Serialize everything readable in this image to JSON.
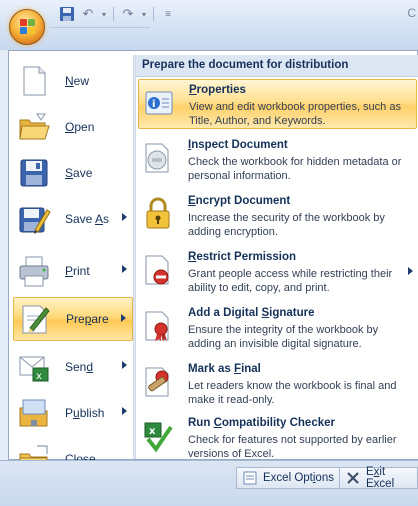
{
  "title_bar": {
    "partial_title": "C"
  },
  "left_menu": {
    "items": [
      {
        "label": "New",
        "mnemonic": "N",
        "rest": "ew",
        "has_submenu": false
      },
      {
        "label": "Open",
        "mnemonic": "O",
        "rest": "pen",
        "has_submenu": false
      },
      {
        "label": "Save",
        "mnemonic": "S",
        "rest": "ave",
        "has_submenu": false
      },
      {
        "label_pre": "Save ",
        "mnemonic": "A",
        "rest": "s",
        "has_submenu": true
      },
      {
        "label": "Print",
        "mnemonic": "P",
        "rest": "rint",
        "has_submenu": true
      },
      {
        "label_pre": "Pre",
        "mnemonic": "p",
        "rest": "are",
        "has_submenu": true,
        "selected": true
      },
      {
        "label_pre": "Sen",
        "mnemonic": "d",
        "rest": "",
        "has_submenu": true
      },
      {
        "label_pre": "P",
        "mnemonic": "u",
        "rest": "blish",
        "has_submenu": true
      },
      {
        "label": "Close",
        "mnemonic": "C",
        "rest": "lose",
        "has_submenu": false
      }
    ]
  },
  "right_pane": {
    "heading": "Prepare the document for distribution",
    "items": [
      {
        "title_pre": "",
        "mnemonic": "P",
        "title_post": "roperties",
        "desc": "View and edit workbook properties, such as Title, Author, and Keywords.",
        "selected": true
      },
      {
        "title_pre": "",
        "mnemonic": "I",
        "title_post": "nspect Document",
        "desc": "Check the workbook for hidden metadata or personal information."
      },
      {
        "title_pre": "",
        "mnemonic": "E",
        "title_post": "ncrypt Document",
        "desc": "Increase the security of the workbook by adding encryption."
      },
      {
        "title_pre": "",
        "mnemonic": "R",
        "title_post": "estrict Permission",
        "desc": "Grant people access while restricting their ability to edit, copy, and print.",
        "has_submenu": true
      },
      {
        "title_pre": "Add a Digital ",
        "mnemonic": "S",
        "title_post": "ignature",
        "desc": "Ensure the integrity of the workbook by adding an invisible digital signature."
      },
      {
        "title_pre": "Mark as ",
        "mnemonic": "F",
        "title_post": "inal",
        "desc": "Let readers know the workbook is final and make it read-only."
      },
      {
        "title_pre": "Run ",
        "mnemonic": "C",
        "title_post": "ompatibility Checker",
        "desc": "Check for features not supported by earlier versions of Excel."
      }
    ]
  },
  "bottom_bar": {
    "options_pre": "Excel Opt",
    "options_mn": "i",
    "options_post": "ons",
    "exit_pre": "E",
    "exit_mn": "x",
    "exit_post": "it Excel"
  }
}
